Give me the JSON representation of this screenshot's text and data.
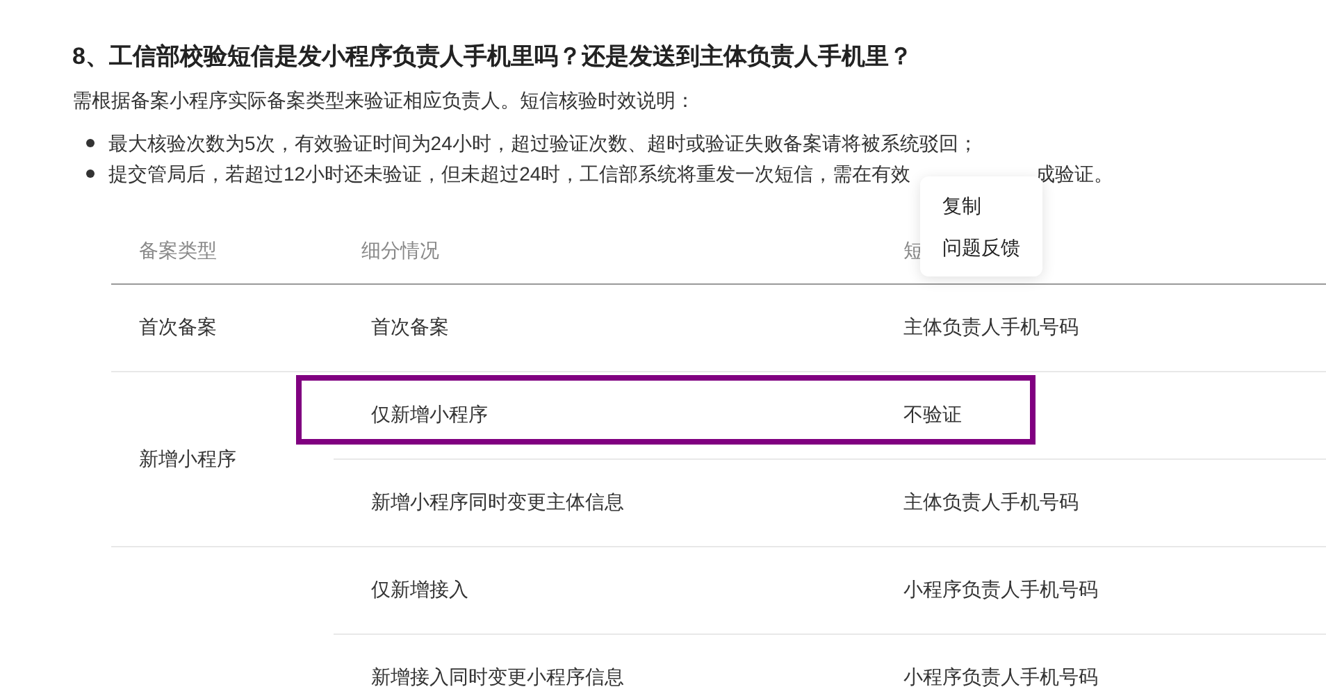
{
  "title": "8、工信部校验短信是发小程序负责人手机里吗？还是发送到主体负责人手机里？",
  "intro": "需根据备案小程序实际备案类型来验证相应负责人。短信核验时效说明：",
  "bullets": [
    {
      "parts": [
        "最大核验次数为5次，有效验证时间为24小时，超过验证次数、超时或验证失败备案请将被系统驳回；"
      ]
    },
    {
      "parts": [
        "提交管局后，若超过12小时还未验证，但未超过24时，工信部系统将重发一次短信，需在有效",
        "成验证。"
      ]
    }
  ],
  "table": {
    "columns": [
      "备案类型",
      "细分情况",
      "短"
    ],
    "groups": [
      {
        "type": "首次备案",
        "rows": [
          {
            "detail": "首次备案",
            "receiver": "主体负责人手机号码",
            "highlighted": false
          }
        ]
      },
      {
        "type": "新增小程序",
        "rows": [
          {
            "detail": "仅新增小程序",
            "receiver": "不验证",
            "highlighted": true
          },
          {
            "detail": "新增小程序同时变更主体信息",
            "receiver": "主体负责人手机号码",
            "highlighted": false
          }
        ]
      },
      {
        "rows": [
          {
            "detail": "仅新增接入",
            "receiver": "小程序负责人手机号码",
            "highlighted": false
          },
          {
            "detail": "新增接入同时变更小程序信息",
            "receiver": "小程序负责人手机号码",
            "highlighted": false
          }
        ]
      }
    ]
  },
  "context_menu": [
    "复制",
    "问题反馈"
  ]
}
